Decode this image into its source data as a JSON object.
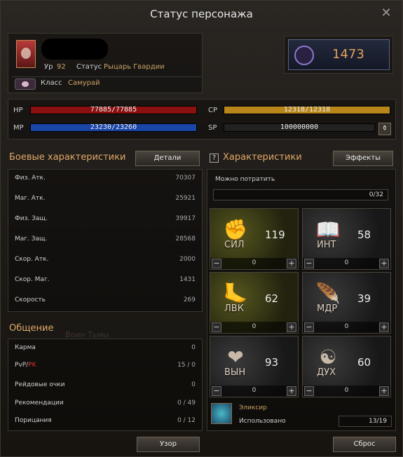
{
  "title": "Статус персонажа",
  "character": {
    "level_label": "Ур",
    "level": "92",
    "status_label": "Статус",
    "status": "Рыцарь Гвардии",
    "class_label": "Класс",
    "class": "Самурай",
    "cp_score": "1473"
  },
  "vitals": {
    "hp_label": "HP",
    "hp": "77885/77885",
    "hp_fill": 1.0,
    "mp_label": "MP",
    "mp": "23230/23260",
    "mp_fill": 0.9987,
    "cp_label": "CP",
    "cp": "12318/12318",
    "cp_fill": 1.0,
    "sp_label": "SP",
    "sp": "100000000"
  },
  "combat": {
    "title": "Боевые характеристики",
    "details_button": "Детали",
    "rows": [
      {
        "k": "Физ. Атк.",
        "v": "70307"
      },
      {
        "k": "Маг. Атк.",
        "v": "25921"
      },
      {
        "k": "Физ. Защ.",
        "v": "39917"
      },
      {
        "k": "Маг. Защ.",
        "v": "28568"
      },
      {
        "k": "Скор. Атк.",
        "v": "2000"
      },
      {
        "k": "Скор. Маг.",
        "v": "1431"
      },
      {
        "k": "Скорость",
        "v": "269"
      }
    ]
  },
  "social": {
    "title": "Общение",
    "background_text": "Воин Тьмы",
    "karma_label": "Карма",
    "karma": "0",
    "pvp_label": "PvP/",
    "pk_label": "PK",
    "pvp": "15 / 0",
    "raid_label": "Рейдовые очки",
    "raid": "0",
    "rec_label": "Рекомендации",
    "rec": "0 / 49",
    "blame_label": "Порицания",
    "blame": "0 / 12"
  },
  "stats": {
    "title": "Характеристики",
    "help": "?",
    "effects_button": "Эффекты",
    "spend_label": "Можно потратить",
    "spend_value": "0/32",
    "items": [
      {
        "name": "СИЛ",
        "value": "119",
        "add": "0",
        "icon": "fist-icon",
        "glyph": "✊"
      },
      {
        "name": "ИНТ",
        "value": "58",
        "add": "0",
        "icon": "book-icon",
        "glyph": "📖"
      },
      {
        "name": "ЛВК",
        "value": "62",
        "add": "0",
        "icon": "foot-icon",
        "glyph": "🦶"
      },
      {
        "name": "МДР",
        "value": "39",
        "add": "0",
        "icon": "feather-icon",
        "glyph": "🪶"
      },
      {
        "name": "ВЫН",
        "value": "93",
        "add": "0",
        "icon": "heart-icon",
        "glyph": "❤"
      },
      {
        "name": "ДУХ",
        "value": "60",
        "add": "0",
        "icon": "brain-icon",
        "glyph": "☯"
      }
    ],
    "minus": "−",
    "plus": "+"
  },
  "elixir": {
    "label": "Эликсир",
    "used_label": "Использовано",
    "used": "13/19"
  },
  "buttons": {
    "pattern": "Узор",
    "reset": "Сброс"
  },
  "colors": {
    "hp": "#8b1010",
    "mp": "#1a46a8",
    "cp": "#b8861a",
    "accent": "#e0a868"
  }
}
